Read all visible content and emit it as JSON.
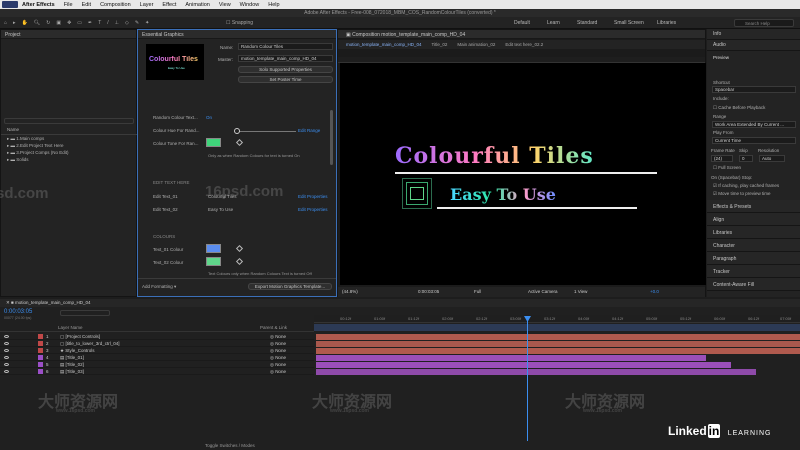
{
  "menubar": {
    "app_name": "After Effects",
    "items": [
      "File",
      "Edit",
      "Composition",
      "Layer",
      "Effect",
      "Animation",
      "View",
      "Window",
      "Help"
    ],
    "clock": ""
  },
  "title": "Adobe After Effects - Free-008_072018_MBM_COS_RandomColourTiles (converted) *",
  "toolbar": {
    "snapping_label": "Snapping",
    "workspaces": [
      "Default",
      "Learn",
      "Standard",
      "Small Screen",
      "Libraries"
    ],
    "search_placeholder": "Search Help"
  },
  "project_panel": {
    "title": "Project",
    "column_name": "Name",
    "items": [
      "1.Main comps",
      "2.Edit Project Text Here",
      "3.Project Comps (No Edit)",
      "Solids"
    ]
  },
  "essential_graphics": {
    "title": "Essential Graphics",
    "name_label": "Name:",
    "name_value": "Random Colour Tiles",
    "master_label": "Master:",
    "master_value": "motion_template_main_comp_HD_04",
    "solo_button": "Solo Supported Properties",
    "poster_button": "Set Poster Time",
    "props": [
      {
        "label": "Random Colour Text...",
        "value": "On"
      },
      {
        "label": "Colour Hue For Rand...",
        "value": "Edit Range"
      },
      {
        "label": "Colour Tone For Ran...",
        "value": ""
      }
    ],
    "note_random": "Only as when Random Colours for text is turned On",
    "section_edit": "EDIT TEXT HERE",
    "text_rows": [
      {
        "label": "Edit Text_01",
        "value": "Colourful Tiles",
        "action": "Edit Properties"
      },
      {
        "label": "Edit Text_02",
        "value": "Easy To Use",
        "action": "Edit Properties"
      }
    ],
    "section_colours": "COLOURS",
    "colour_rows": [
      {
        "label": "Text_01 Colour",
        "color": "#5b8def"
      },
      {
        "label": "Text_02 Colour",
        "color": "#5fd68a"
      }
    ],
    "note_colours": "Text Colours only when Random Colours Text is turned Off",
    "add_formatting": "Add Formatting",
    "export_button": "Export Motion Graphics Template...",
    "tone_color": "#3fd47a"
  },
  "composition": {
    "panel_title": "Composition motion_template_main_comp_HD_04",
    "tabs": [
      "motion_template_main_comp_HD_04",
      "Title_02",
      "Main animation_02",
      "Edit text here_02.2"
    ],
    "title_text": "Colourful Tiles",
    "subtitle_text": "Easy To Use",
    "footer": {
      "zoom": "(44.8%)",
      "timecode": "0:00:03:05",
      "resolution": "Full",
      "camera": "Active Camera",
      "views": "1 View",
      "offset": "+0.0"
    }
  },
  "right_panel": {
    "tabs": [
      "Info",
      "Audio"
    ],
    "preview_title": "Preview",
    "shortcut_label": "Shortcut",
    "shortcut_value": "Spacebar",
    "include_label": "Include:",
    "cache_label": "Cache Before Playback",
    "range_label": "Range",
    "range_value": "Work Area Extended By Current ...",
    "play_from_label": "Play From",
    "play_from_value": "Current Time",
    "frame_rate_label": "Frame Rate",
    "skip_label": "Skip",
    "resolution_label": "Resolution",
    "frame_rate_value": "(24)",
    "skip_value": "0",
    "resolution_value": "Auto",
    "full_screen": "Full Screen",
    "on_stop_label": "On (Spacebar) Stop:",
    "on_stop_opt1": "If caching, play cached frames",
    "on_stop_opt2": "Move time to preview time",
    "panels": [
      "Effects & Presets",
      "Align",
      "Libraries",
      "Character",
      "Paragraph",
      "Tracker",
      "Content-Aware Fill"
    ]
  },
  "timeline": {
    "comp_tab": "motion_template_main_comp_HD_04",
    "timecode": "0:00:03:05",
    "timecode_sub": "00077 (24.00 fps)",
    "search_placeholder": "",
    "col_layer_name": "Layer Name",
    "col_parent": "Parent & Link",
    "layers": [
      {
        "num": "1",
        "name": "[Project Controls]",
        "parent": "None",
        "label_color": "#c04848",
        "bar_color": "#b05a4e"
      },
      {
        "num": "2",
        "name": "[title_to_lower_3rd_ctrl_04]",
        "parent": "None",
        "label_color": "#c04848",
        "bar_color": "#b05a4e"
      },
      {
        "num": "3",
        "name": "Style_Controls",
        "parent": "None",
        "label_color": "#c04848",
        "bar_color": "#b05a4e"
      },
      {
        "num": "4",
        "name": "[Title_01]",
        "parent": "None",
        "label_color": "#9b4fc7",
        "bar_color": "#9b4fb9"
      },
      {
        "num": "5",
        "name": "[Title_02]",
        "parent": "None",
        "label_color": "#9b4fc7",
        "bar_color": "#9b4fb9"
      },
      {
        "num": "6",
        "name": "[Title_03]",
        "parent": "None",
        "label_color": "#9b4fc7",
        "bar_color": "#9b4fb9"
      }
    ],
    "ruler_ticks": [
      "00:12f",
      "01:00f",
      "01:12f",
      "02:00f",
      "02:12f",
      "03:00f",
      "03:12f",
      "04:00f",
      "04:12f",
      "05:00f",
      "05:12f",
      "06:00f",
      "06:12f",
      "07:00f"
    ],
    "toggle_label": "Toggle Switches / Modes"
  },
  "branding": {
    "linkedin_text": "Linked",
    "linkedin_in": "in",
    "learning": "LEARNING"
  },
  "watermarks": {
    "site": "sd.com",
    "site2": "16psd.com",
    "cn": "大师资源网",
    "cn_url": "www.16psd.com"
  },
  "colors": {
    "accent": "#3b8ef0",
    "playhead": "#3b8ef0",
    "title_gradient": [
      "#9c6bff",
      "#ff7ac4",
      "#ffd36a",
      "#5ee8c8"
    ],
    "subtitle_gradient": [
      "#4ad6ff",
      "#2ee6a6",
      "#ff9ecb",
      "#6b8cff"
    ]
  }
}
